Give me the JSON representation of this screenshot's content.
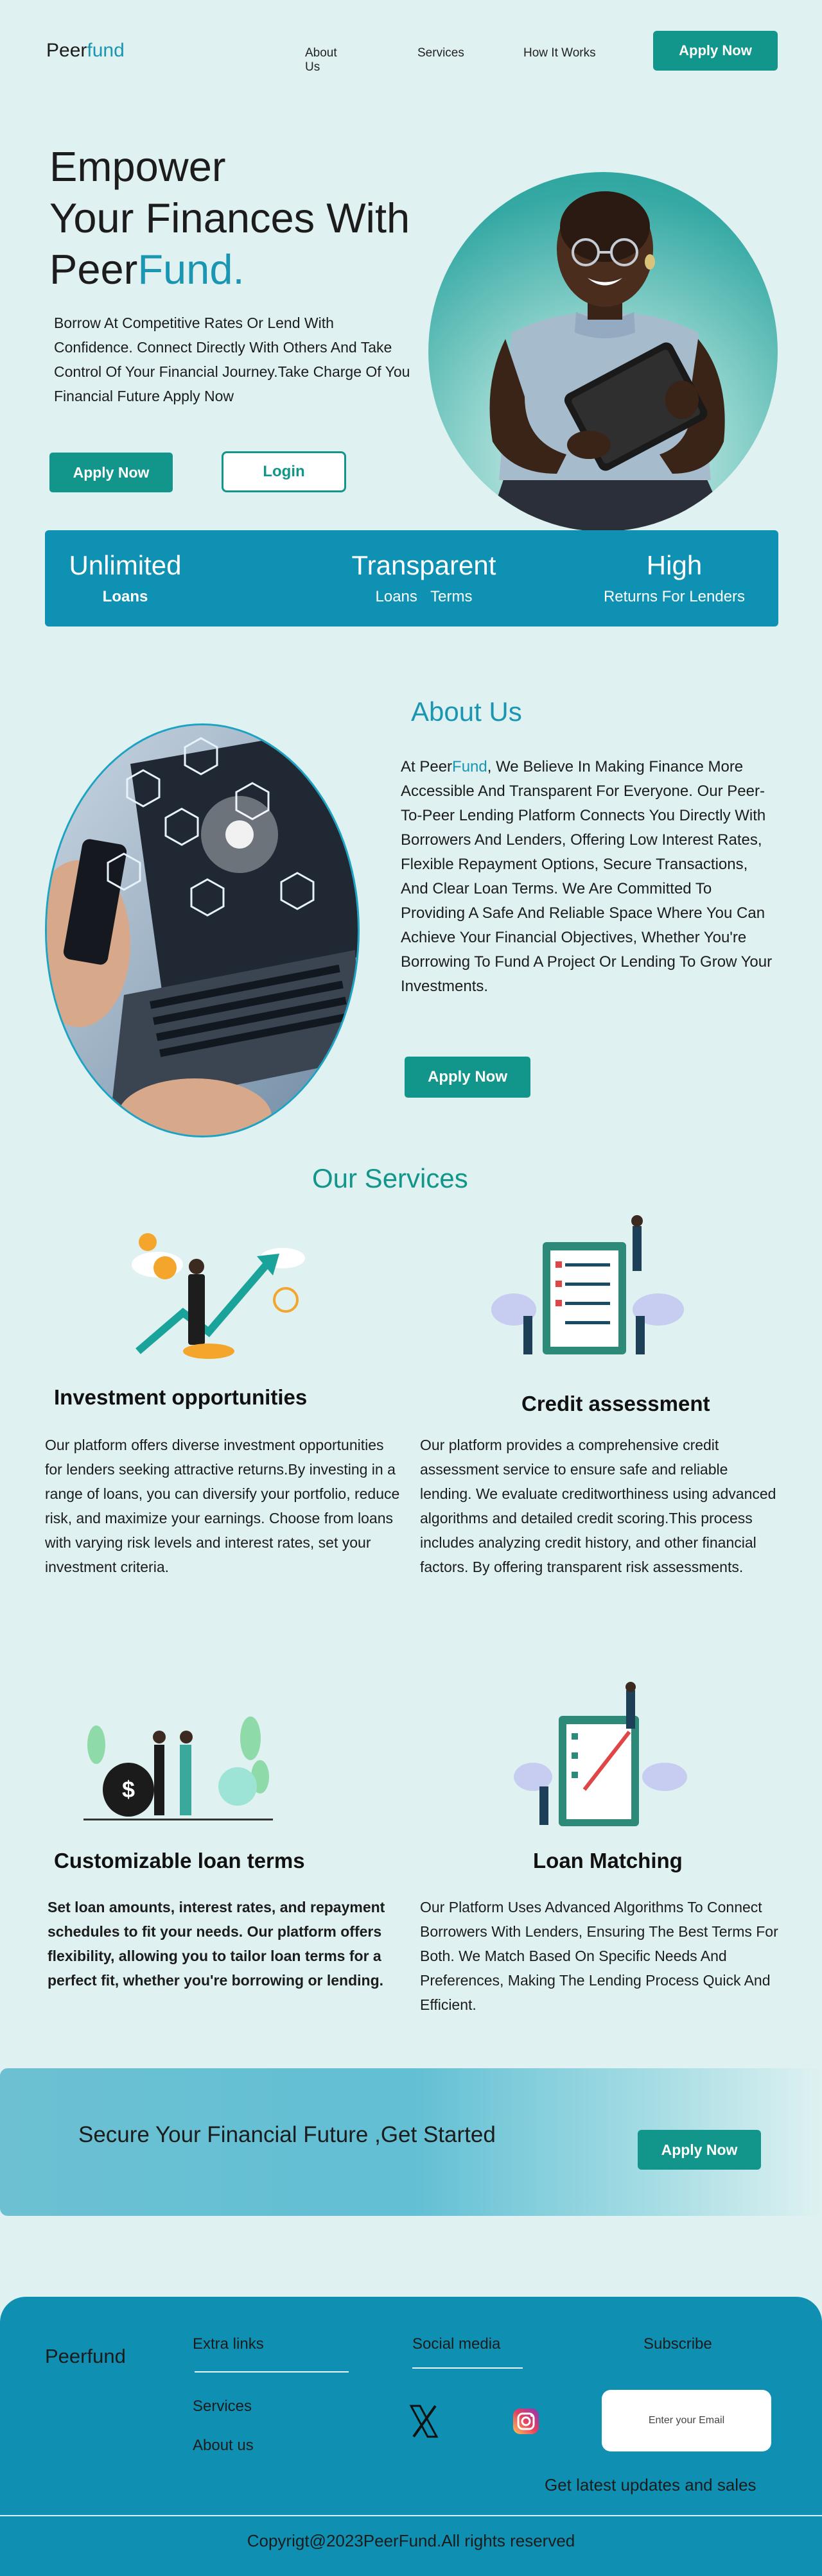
{
  "nav": {
    "logo_part1": "Peer",
    "logo_part2": "fund",
    "links": [
      "About Us",
      "Services",
      "How It Works"
    ],
    "apply_label": "Apply Now"
  },
  "hero": {
    "title_line1": "Empower",
    "title_line2": "Your Finances With",
    "title_line3_part1": "Peer",
    "title_line3_part2": "Fund.",
    "description": "Borrow At Competitive Rates Or Lend With Confidence. Connect Directly With Others And Take Control Of Your Financial Journey.Take Charge Of You Financial Future Apply Now",
    "apply_label": "Apply Now",
    "login_label": "Login"
  },
  "stats": [
    {
      "big": "Unlimited",
      "small": "Loans"
    },
    {
      "big": "Transparent",
      "small": "Loans Terms"
    },
    {
      "big": "High",
      "small": "Returns For Lenders"
    }
  ],
  "about": {
    "title": "About Us",
    "text_prefix": "At Peer",
    "text_accent": "Fund",
    "text_rest": ", We Believe In Making Finance More Accessible And Transparent For Everyone. Our Peer-To-Peer Lending Platform Connects You Directly With Borrowers And Lenders, Offering Low Interest Rates, Flexible Repayment Options, Secure Transactions, And Clear Loan Terms. We Are Committed To Providing A Safe And Reliable Space Where You Can Achieve Your Financial Objectives, Whether You're Borrowing To Fund A Project Or Lending To Grow Your Investments.",
    "apply_label": "Apply Now"
  },
  "services": {
    "title": "Our Services",
    "items": [
      {
        "heading": "Investment opportunities",
        "text": "Our platform offers diverse investment opportunities for lenders seeking attractive returns.By investing in a range of loans, you can diversify your portfolio, reduce risk, and maximize your earnings. Choose from loans with varying risk levels and interest rates, set your investment criteria."
      },
      {
        "heading": "Credit assessment",
        "text": "Our platform provides a comprehensive credit assessment service to ensure safe and reliable lending. We evaluate creditworthiness using advanced algorithms and detailed credit scoring.This process includes analyzing credit history, and other financial factors. By offering transparent risk assessments."
      },
      {
        "heading": "Customizable loan terms",
        "text": "Set loan amounts, interest rates, and repayment schedules to fit your needs. Our platform offers flexibility, allowing you to tailor loan terms for a perfect fit, whether you're borrowing or lending."
      },
      {
        "heading": "Loan Matching",
        "text": "Our Platform Uses Advanced Algorithms To Connect Borrowers With Lenders, Ensuring The Best Terms For Both. We Match Based On Specific Needs And Preferences, Making The Lending Process Quick And Efficient."
      }
    ]
  },
  "cta": {
    "text": "Secure Your Financial Future ,Get Started",
    "button_label": "Apply Now"
  },
  "footer": {
    "logo": "Peerfund",
    "extra_links_heading": "Extra links",
    "extra_links": [
      "Services",
      "About us"
    ],
    "social_heading": "Social media",
    "subscribe_heading": "Subscribe",
    "email_placeholder": "Enter your Email",
    "updates_text": "Get latest updates and sales",
    "copyright": "Copyrigt@2023PeerFund.All rights reserved"
  },
  "colors": {
    "background": "#e0f1f1",
    "accent_blue": "#1a96b2",
    "teal_button": "#12958a",
    "stats_band": "#0e91b2",
    "footer": "#0f8fb2"
  }
}
